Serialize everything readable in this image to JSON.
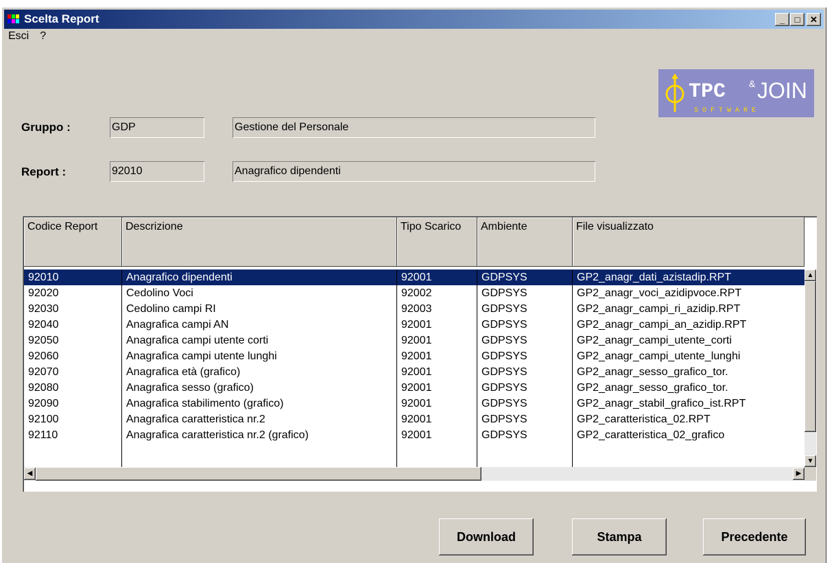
{
  "window": {
    "title": "Scelta Report"
  },
  "menu": [
    "Esci",
    "?"
  ],
  "logo": {
    "text_main": "TPC",
    "text_join": "JOIN",
    "text_sub": "S O F T W A R E"
  },
  "form": {
    "gruppo_label": "Gruppo :",
    "gruppo_code": "GDP",
    "gruppo_desc": "Gestione del Personale",
    "report_label": "Report :",
    "report_code": "92010",
    "report_desc": "Anagrafico dipendenti"
  },
  "table": {
    "headers": [
      "Codice Report",
      "Descrizione",
      "Tipo Scarico",
      "Ambiente",
      "File visualizzato"
    ],
    "rows": [
      [
        "92010",
        "Anagrafico dipendenti",
        "92001",
        "GDPSYS",
        "GP2_anagr_dati_azistadip.RPT"
      ],
      [
        "92020",
        "Cedolino Voci",
        "92002",
        "GDPSYS",
        "GP2_anagr_voci_azidipvoce.RPT"
      ],
      [
        "92030",
        "Cedolino campi RI",
        "92003",
        "GDPSYS",
        "GP2_anagr_campi_ri_azidip.RPT"
      ],
      [
        "92040",
        "Anagrafica campi AN",
        "92001",
        "GDPSYS",
        "GP2_anagr_campi_an_azidip.RPT"
      ],
      [
        "92050",
        "Anagrafica campi utente corti",
        "92001",
        "GDPSYS",
        "GP2_anagr_campi_utente_corti"
      ],
      [
        "92060",
        "Anagrafica campi utente lunghi",
        "92001",
        "GDPSYS",
        "GP2_anagr_campi_utente_lunghi"
      ],
      [
        "92070",
        "Anagrafica età (grafico)",
        "92001",
        "GDPSYS",
        "GP2_anagr_sesso_grafico_tor."
      ],
      [
        "92080",
        "Anagrafica sesso (grafico)",
        "92001",
        "GDPSYS",
        "GP2_anagr_sesso_grafico_tor."
      ],
      [
        "92090",
        "Anagrafica stabilimento (grafico)",
        "92001",
        "GDPSYS",
        "GP2_anagr_stabil_grafico_ist.RPT"
      ],
      [
        "92100",
        "Anagrafica caratteristica nr.2",
        "92001",
        "GDPSYS",
        "GP2_caratteristica_02.RPT"
      ],
      [
        "92110",
        "Anagrafica caratteristica nr.2 (grafico)",
        "92001",
        "GDPSYS",
        "GP2_caratteristica_02_grafico"
      ]
    ],
    "selected_index": 0
  },
  "buttons": {
    "download": "Download",
    "stampa": "Stampa",
    "precedente": "Precedente"
  }
}
